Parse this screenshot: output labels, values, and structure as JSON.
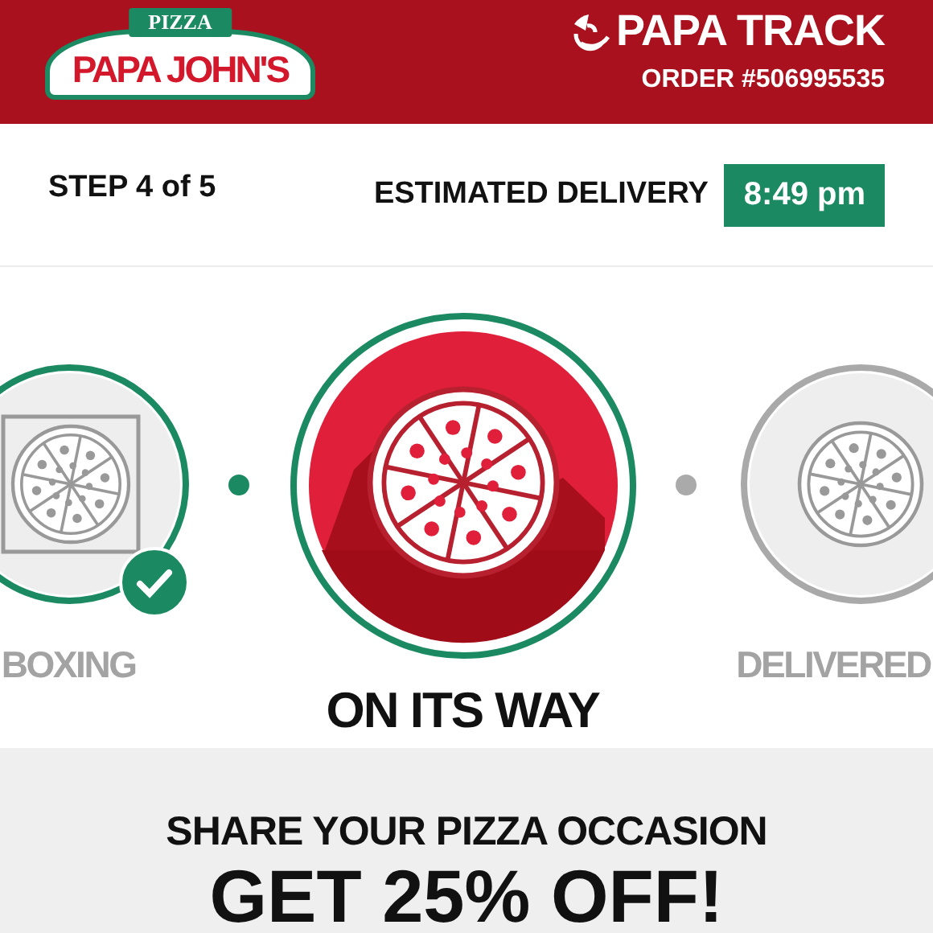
{
  "header": {
    "logo": {
      "banner": "PIZZA",
      "name": "PAPA JOHN'S"
    },
    "title": "PAPA TRACK",
    "order": "ORDER #506995535"
  },
  "progress": {
    "step": "STEP 4 of 5",
    "eta_label": "ESTIMATED DELIVERY",
    "eta": "8:49 pm"
  },
  "steps": [
    {
      "label": "BOXING",
      "completed": true,
      "selected": false,
      "kind": "box"
    },
    {
      "label": "ON ITS WAY",
      "completed": false,
      "selected": true,
      "kind": "road"
    },
    {
      "label": "DELIVERED",
      "completed": false,
      "selected": false,
      "kind": "plain"
    }
  ],
  "promo": {
    "subtitle": "SHARE YOUR PIZZA OCCASION",
    "headline": "GET 25% OFF!"
  }
}
